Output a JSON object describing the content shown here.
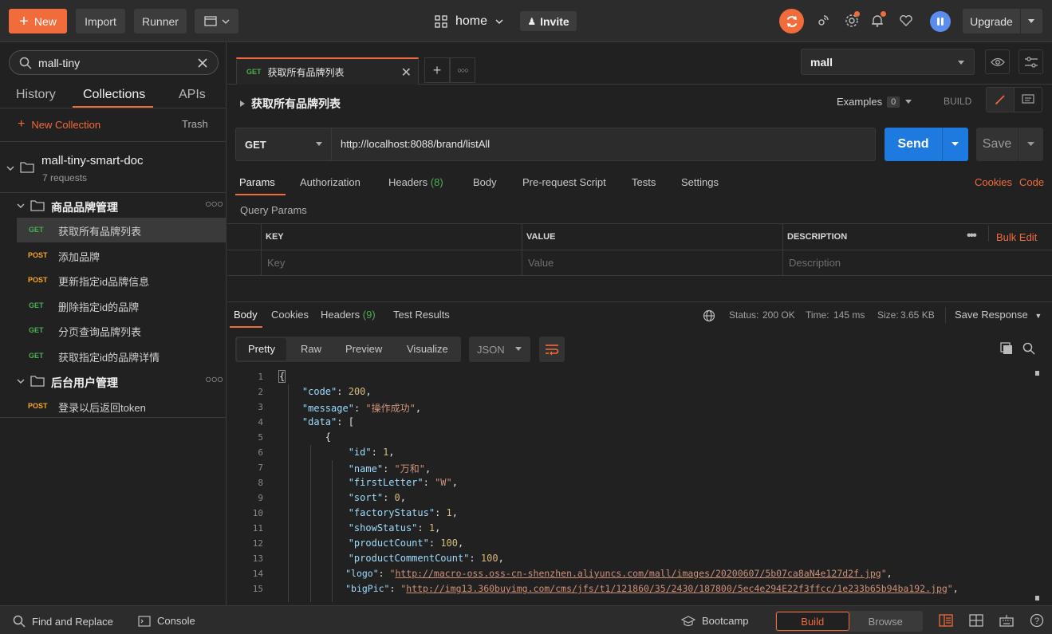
{
  "topbar": {
    "new_label": "New",
    "import_label": "Import",
    "runner_label": "Runner",
    "workspace": "home",
    "invite_label": "Invite",
    "upgrade_label": "Upgrade"
  },
  "sidebar": {
    "search_value": "mall-tiny",
    "tabs": [
      "History",
      "Collections",
      "APIs"
    ],
    "new_collection": "New Collection",
    "trash": "Trash",
    "collection": {
      "name": "mall-tiny-smart-doc",
      "count": "7 requests"
    },
    "folders": [
      {
        "name": "商品品牌管理"
      },
      {
        "name": "后台用户管理"
      }
    ],
    "requests": [
      {
        "method": "GET",
        "name": "获取所有品牌列表"
      },
      {
        "method": "POST",
        "name": "添加品牌"
      },
      {
        "method": "POST",
        "name": "更新指定id品牌信息"
      },
      {
        "method": "GET",
        "name": "删除指定id的品牌"
      },
      {
        "method": "GET",
        "name": "分页查询品牌列表"
      },
      {
        "method": "GET",
        "name": "获取指定id的品牌详情"
      },
      {
        "method": "POST",
        "name": "登录以后返回token"
      }
    ]
  },
  "main": {
    "tab": {
      "method": "GET",
      "title": "获取所有品牌列表"
    },
    "environment": "mall",
    "request_title": "获取所有品牌列表",
    "examples_label": "Examples",
    "examples_count": "0",
    "build_label": "BUILD",
    "method": "GET",
    "url": "http://localhost:8088/brand/listAll",
    "send_label": "Send",
    "save_label": "Save",
    "request_tabs": {
      "params": "Params",
      "authorization": "Authorization",
      "headers": "Headers",
      "headers_count": "(8)",
      "body": "Body",
      "prerequest": "Pre-request Script",
      "tests": "Tests",
      "settings": "Settings",
      "cookies": "Cookies",
      "code": "Code"
    },
    "query_params_label": "Query Params",
    "params_table": {
      "headers": [
        "KEY",
        "VALUE",
        "DESCRIPTION"
      ],
      "placeholders": [
        "Key",
        "Value",
        "Description"
      ],
      "bulk_edit": "Bulk Edit"
    },
    "response": {
      "tabs": {
        "body": "Body",
        "cookies": "Cookies",
        "headers": "Headers",
        "headers_count": "(9)",
        "tests": "Test Results"
      },
      "status_label": "Status:",
      "status_value": "200 OK",
      "time_label": "Time:",
      "time_value": "145 ms",
      "size_label": "Size:",
      "size_value": "3.65 KB",
      "save_response": "Save Response",
      "formats": [
        "Pretty",
        "Raw",
        "Preview",
        "Visualize"
      ],
      "language": "JSON"
    },
    "code_lines": [
      {
        "n": "1"
      },
      {
        "n": "2"
      },
      {
        "n": "3"
      },
      {
        "n": "4"
      },
      {
        "n": "5"
      },
      {
        "n": "6"
      },
      {
        "n": "7"
      },
      {
        "n": "8"
      },
      {
        "n": "9"
      },
      {
        "n": "10"
      },
      {
        "n": "11"
      },
      {
        "n": "12"
      },
      {
        "n": "13"
      },
      {
        "n": "14"
      },
      {
        "n": "15"
      }
    ],
    "json": {
      "code_key": "\"code\"",
      "code_val": "200",
      "message_key": "\"message\"",
      "message_val": "\"操作成功\"",
      "data_key": "\"data\"",
      "id_key": "\"id\"",
      "id_val": "1",
      "name_key": "\"name\"",
      "name_val": "\"万和\"",
      "firstLetter_key": "\"firstLetter\"",
      "firstLetter_val": "\"W\"",
      "sort_key": "\"sort\"",
      "sort_val": "0",
      "factoryStatus_key": "\"factoryStatus\"",
      "factoryStatus_val": "1",
      "showStatus_key": "\"showStatus\"",
      "showStatus_val": "1",
      "productCount_key": "\"productCount\"",
      "productCount_val": "100",
      "productCommentCount_key": "\"productCommentCount\"",
      "productCommentCount_val": "100",
      "logo_key": "\"logo\"",
      "logo_val": "http://macro-oss.oss-cn-shenzhen.aliyuncs.com/mall/images/20200607/5b07ca8aN4e127d2f.jpg",
      "bigPic_key": "\"bigPic\"",
      "bigPic_val": "http://img13.360buyimg.com/cms/jfs/t1/121860/35/2430/187800/5ec4e294E22f3ffcc/1e233b65b94ba192.jpg"
    }
  },
  "bottombar": {
    "find_replace": "Find and Replace",
    "console": "Console",
    "bootcamp": "Bootcamp",
    "build": "Build",
    "browse": "Browse"
  },
  "colors": {
    "accent": "#f26b3a",
    "send": "#1f7ae0",
    "get": "#4caf50",
    "post": "#f5a623"
  }
}
